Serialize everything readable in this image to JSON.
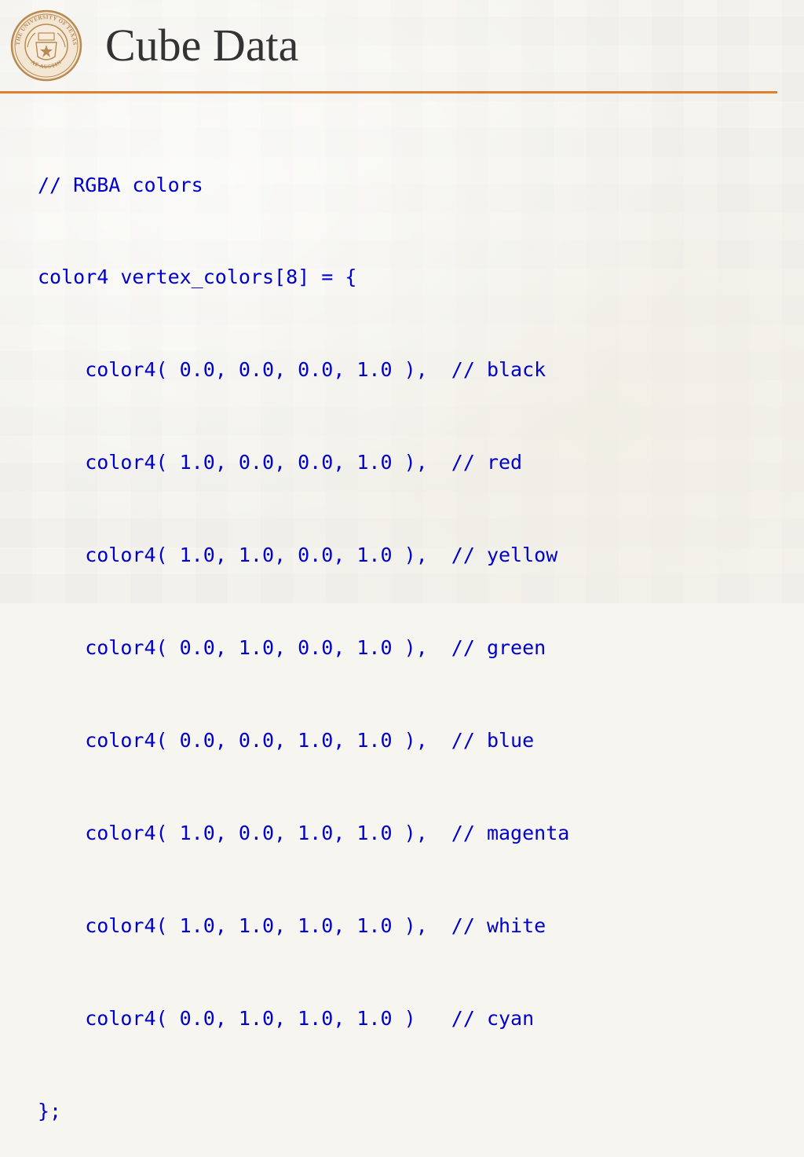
{
  "slide": {
    "title": "Cube Data",
    "colors": {
      "title": "#333333",
      "rule": "#e0802e",
      "code": "#0000cc",
      "seal": "#b98a52"
    },
    "logo": {
      "icon": "university-seal-icon",
      "ring_top_text": "THE UNIVERSITY OF TEXAS",
      "ring_bottom_text": "AT AUSTIN"
    },
    "code_lines": [
      "// RGBA colors",
      "color4 vertex_colors[8] = {",
      "    color4( 0.0, 0.0, 0.0, 1.0 ),  // black",
      "    color4( 1.0, 0.0, 0.0, 1.0 ),  // red",
      "    color4( 1.0, 1.0, 0.0, 1.0 ),  // yellow",
      "    color4( 0.0, 1.0, 0.0, 1.0 ),  // green",
      "    color4( 0.0, 0.0, 1.0, 1.0 ),  // blue",
      "    color4( 1.0, 0.0, 1.0, 1.0 ),  // magenta",
      "    color4( 1.0, 1.0, 1.0, 1.0 ),  // white",
      "    color4( 0.0, 1.0, 1.0, 1.0 )   // cyan",
      "};"
    ]
  }
}
